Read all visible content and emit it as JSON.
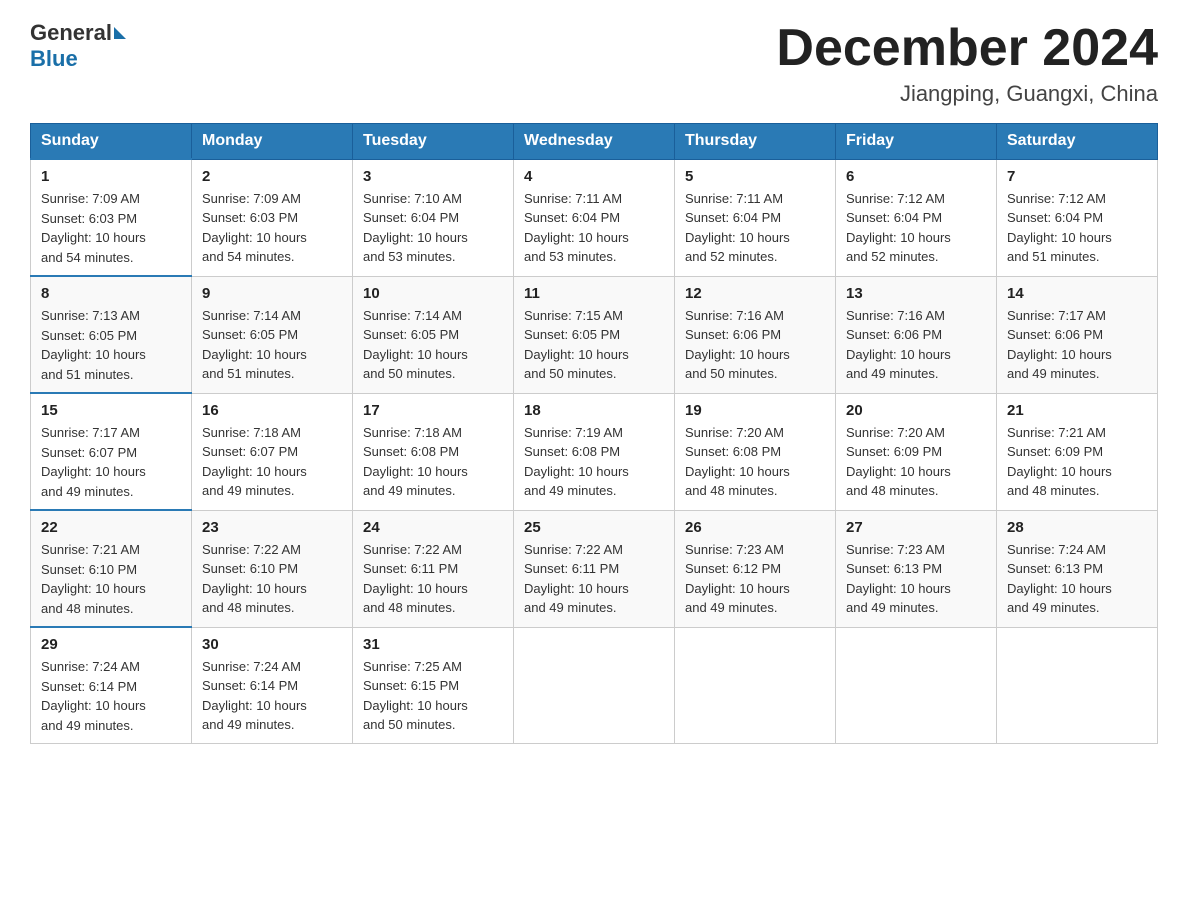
{
  "header": {
    "logo_general": "General",
    "logo_blue": "Blue",
    "month_title": "December 2024",
    "location": "Jiangping, Guangxi, China"
  },
  "columns": [
    "Sunday",
    "Monday",
    "Tuesday",
    "Wednesday",
    "Thursday",
    "Friday",
    "Saturday"
  ],
  "weeks": [
    [
      {
        "day": "1",
        "sunrise": "7:09 AM",
        "sunset": "6:03 PM",
        "daylight": "10 hours and 54 minutes."
      },
      {
        "day": "2",
        "sunrise": "7:09 AM",
        "sunset": "6:03 PM",
        "daylight": "10 hours and 54 minutes."
      },
      {
        "day": "3",
        "sunrise": "7:10 AM",
        "sunset": "6:04 PM",
        "daylight": "10 hours and 53 minutes."
      },
      {
        "day": "4",
        "sunrise": "7:11 AM",
        "sunset": "6:04 PM",
        "daylight": "10 hours and 53 minutes."
      },
      {
        "day": "5",
        "sunrise": "7:11 AM",
        "sunset": "6:04 PM",
        "daylight": "10 hours and 52 minutes."
      },
      {
        "day": "6",
        "sunrise": "7:12 AM",
        "sunset": "6:04 PM",
        "daylight": "10 hours and 52 minutes."
      },
      {
        "day": "7",
        "sunrise": "7:12 AM",
        "sunset": "6:04 PM",
        "daylight": "10 hours and 51 minutes."
      }
    ],
    [
      {
        "day": "8",
        "sunrise": "7:13 AM",
        "sunset": "6:05 PM",
        "daylight": "10 hours and 51 minutes."
      },
      {
        "day": "9",
        "sunrise": "7:14 AM",
        "sunset": "6:05 PM",
        "daylight": "10 hours and 51 minutes."
      },
      {
        "day": "10",
        "sunrise": "7:14 AM",
        "sunset": "6:05 PM",
        "daylight": "10 hours and 50 minutes."
      },
      {
        "day": "11",
        "sunrise": "7:15 AM",
        "sunset": "6:05 PM",
        "daylight": "10 hours and 50 minutes."
      },
      {
        "day": "12",
        "sunrise": "7:16 AM",
        "sunset": "6:06 PM",
        "daylight": "10 hours and 50 minutes."
      },
      {
        "day": "13",
        "sunrise": "7:16 AM",
        "sunset": "6:06 PM",
        "daylight": "10 hours and 49 minutes."
      },
      {
        "day": "14",
        "sunrise": "7:17 AM",
        "sunset": "6:06 PM",
        "daylight": "10 hours and 49 minutes."
      }
    ],
    [
      {
        "day": "15",
        "sunrise": "7:17 AM",
        "sunset": "6:07 PM",
        "daylight": "10 hours and 49 minutes."
      },
      {
        "day": "16",
        "sunrise": "7:18 AM",
        "sunset": "6:07 PM",
        "daylight": "10 hours and 49 minutes."
      },
      {
        "day": "17",
        "sunrise": "7:18 AM",
        "sunset": "6:08 PM",
        "daylight": "10 hours and 49 minutes."
      },
      {
        "day": "18",
        "sunrise": "7:19 AM",
        "sunset": "6:08 PM",
        "daylight": "10 hours and 49 minutes."
      },
      {
        "day": "19",
        "sunrise": "7:20 AM",
        "sunset": "6:08 PM",
        "daylight": "10 hours and 48 minutes."
      },
      {
        "day": "20",
        "sunrise": "7:20 AM",
        "sunset": "6:09 PM",
        "daylight": "10 hours and 48 minutes."
      },
      {
        "day": "21",
        "sunrise": "7:21 AM",
        "sunset": "6:09 PM",
        "daylight": "10 hours and 48 minutes."
      }
    ],
    [
      {
        "day": "22",
        "sunrise": "7:21 AM",
        "sunset": "6:10 PM",
        "daylight": "10 hours and 48 minutes."
      },
      {
        "day": "23",
        "sunrise": "7:22 AM",
        "sunset": "6:10 PM",
        "daylight": "10 hours and 48 minutes."
      },
      {
        "day": "24",
        "sunrise": "7:22 AM",
        "sunset": "6:11 PM",
        "daylight": "10 hours and 48 minutes."
      },
      {
        "day": "25",
        "sunrise": "7:22 AM",
        "sunset": "6:11 PM",
        "daylight": "10 hours and 49 minutes."
      },
      {
        "day": "26",
        "sunrise": "7:23 AM",
        "sunset": "6:12 PM",
        "daylight": "10 hours and 49 minutes."
      },
      {
        "day": "27",
        "sunrise": "7:23 AM",
        "sunset": "6:13 PM",
        "daylight": "10 hours and 49 minutes."
      },
      {
        "day": "28",
        "sunrise": "7:24 AM",
        "sunset": "6:13 PM",
        "daylight": "10 hours and 49 minutes."
      }
    ],
    [
      {
        "day": "29",
        "sunrise": "7:24 AM",
        "sunset": "6:14 PM",
        "daylight": "10 hours and 49 minutes."
      },
      {
        "day": "30",
        "sunrise": "7:24 AM",
        "sunset": "6:14 PM",
        "daylight": "10 hours and 49 minutes."
      },
      {
        "day": "31",
        "sunrise": "7:25 AM",
        "sunset": "6:15 PM",
        "daylight": "10 hours and 50 minutes."
      },
      null,
      null,
      null,
      null
    ]
  ],
  "labels": {
    "sunrise": "Sunrise:",
    "sunset": "Sunset:",
    "daylight": "Daylight:"
  }
}
